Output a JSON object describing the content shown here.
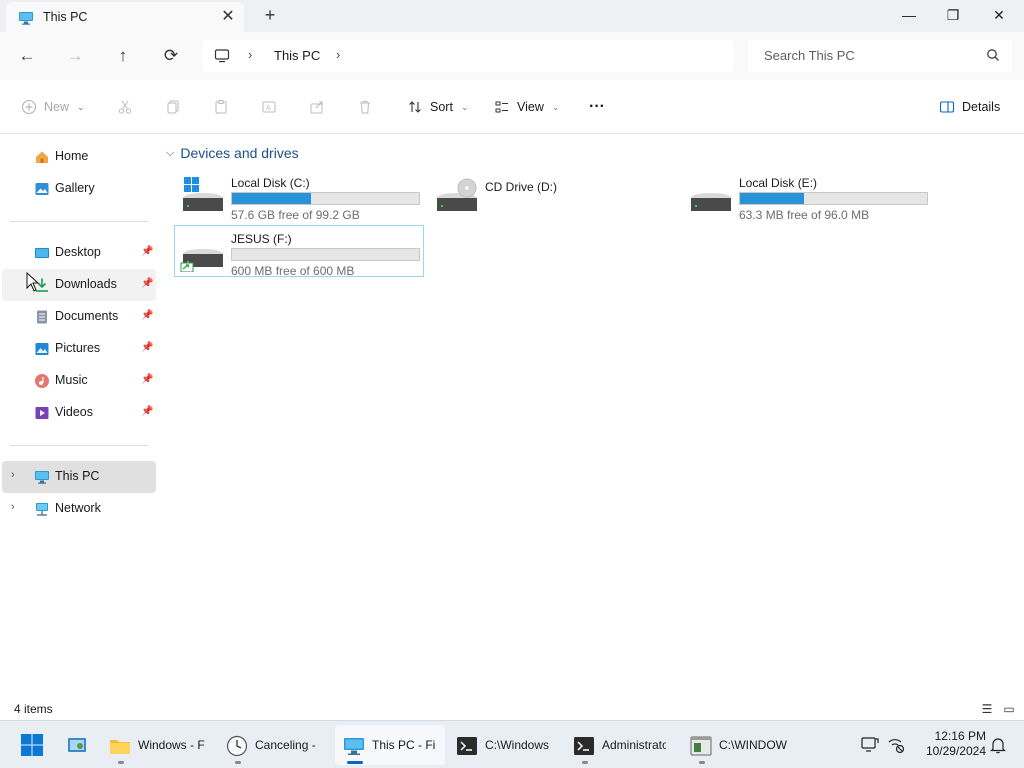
{
  "window": {
    "tab_title": "This PC",
    "tab_icon": "monitor-icon",
    "new_tab": "+",
    "controls": {
      "minimize": "—",
      "maximize": "❐",
      "close": "✕"
    }
  },
  "navigation": {
    "back": "←",
    "forward": "→",
    "up": "↑",
    "refresh": "⟳",
    "breadcrumb": {
      "location": "This PC",
      "separator": "›"
    },
    "search_placeholder": "Search This PC"
  },
  "commandbar": {
    "new_label": "New",
    "sort_label": "Sort",
    "view_label": "View",
    "more": "···",
    "details_label": "Details",
    "disabled_icons": [
      "cut-icon",
      "copy-icon",
      "paste-icon",
      "rename-icon",
      "share-icon",
      "delete-icon"
    ]
  },
  "sidebar": {
    "quick": [
      {
        "label": "Home",
        "icon": "home-icon"
      },
      {
        "label": "Gallery",
        "icon": "gallery-icon"
      }
    ],
    "pinned": [
      {
        "label": "Desktop",
        "icon": "desktop-icon",
        "pinned": true
      },
      {
        "label": "Downloads",
        "icon": "downloads-icon",
        "pinned": true
      },
      {
        "label": "Documents",
        "icon": "documents-icon",
        "pinned": true
      },
      {
        "label": "Pictures",
        "icon": "pictures-icon",
        "pinned": true
      },
      {
        "label": "Music",
        "icon": "music-icon",
        "pinned": true
      },
      {
        "label": "Videos",
        "icon": "videos-icon",
        "pinned": true
      }
    ],
    "locations": [
      {
        "label": "This PC",
        "icon": "this-pc-icon",
        "selected": true
      },
      {
        "label": "Network",
        "icon": "network-icon",
        "selected": false
      }
    ]
  },
  "content": {
    "group_title": "Devices and drives",
    "drives": [
      {
        "name": "Local Disk (C:)",
        "free": "57.6 GB free of 99.2 GB",
        "used_fraction": 0.42,
        "icon": "system-drive-icon",
        "has_bar": true,
        "selected": false
      },
      {
        "name": "CD Drive (D:)",
        "free": "",
        "used_fraction": 0,
        "icon": "cd-drive-icon",
        "has_bar": false,
        "selected": false
      },
      {
        "name": "Local Disk (E:)",
        "free": "63.3 MB free of 96.0 MB",
        "used_fraction": 0.34,
        "icon": "disk-drive-icon",
        "has_bar": true,
        "selected": false
      },
      {
        "name": "JESUS (F:)",
        "free": "600 MB free of 600 MB",
        "used_fraction": 0.0,
        "icon": "removable-drive-icon",
        "has_bar": true,
        "selected": true
      }
    ]
  },
  "status": {
    "item_count": "4 items"
  },
  "taskbar": {
    "apps": [
      {
        "label": "",
        "icon": "control-panel-icon",
        "active": false
      },
      {
        "label": "Windows - F",
        "icon": "folder-icon",
        "active": false
      },
      {
        "label": "Canceling -",
        "icon": "clock-icon",
        "active": false
      },
      {
        "label": "This PC - Fi",
        "icon": "this-pc-icon",
        "active": true
      },
      {
        "label": "C:\\Windows",
        "icon": "terminal-icon",
        "active": false
      },
      {
        "label": "Administrato",
        "icon": "terminal-icon",
        "active": false
      },
      {
        "label": "C:\\WINDOW",
        "icon": "console-window-icon",
        "active": false
      }
    ],
    "time": "12:16 PM",
    "date": "10/29/2024"
  },
  "colors": {
    "accent": "#0a64c8",
    "drive_bar": "#2a92d6",
    "selection_border": "#9fd4f0"
  }
}
